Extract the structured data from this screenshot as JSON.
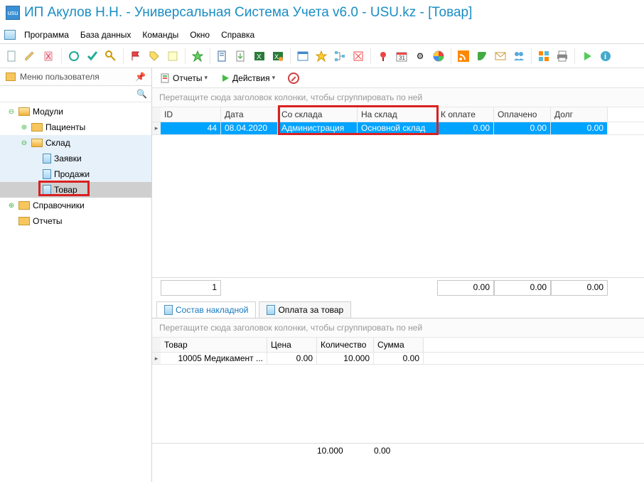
{
  "title": "ИП Акулов Н.Н. - Универсальная Система Учета v6.0 - USU.kz - [Товар]",
  "app_icon_text": "usu",
  "menu": {
    "items": [
      "Программа",
      "База данных",
      "Команды",
      "Окно",
      "Справка"
    ]
  },
  "sidebar": {
    "header": "Меню пользователя",
    "tree": [
      {
        "label": "Модули"
      },
      {
        "label": "Пациенты"
      },
      {
        "label": "Склад"
      },
      {
        "label": "Заявки"
      },
      {
        "label": "Продажи"
      },
      {
        "label": "Товар"
      },
      {
        "label": "Справочники"
      },
      {
        "label": "Отчеты"
      }
    ]
  },
  "content_toolbar": {
    "reports": "Отчеты",
    "actions": "Действия"
  },
  "group_hint": "Перетащите сюда заголовок колонки, чтобы сгруппировать по ней",
  "top_grid": {
    "headers": {
      "id": "ID",
      "date": "Дата",
      "from": "Со склада",
      "to": "На склад",
      "pay": "К оплате",
      "paid": "Оплачено",
      "debt": "Долг"
    },
    "row": {
      "id": "44",
      "date": "08.04.2020",
      "from": "Администрация",
      "to": "Основной склад",
      "pay": "0.00",
      "paid": "0.00",
      "debt": "0.00"
    },
    "footer": {
      "count": "1",
      "pay": "0.00",
      "paid": "0.00",
      "debt": "0.00"
    }
  },
  "tabs": {
    "t1": "Состав накладной",
    "t2": "Оплата за товар"
  },
  "detail_grid": {
    "group_hint": "Перетащите сюда заголовок колонки, чтобы сгруппировать по ней",
    "headers": {
      "name": "Товар",
      "price": "Цена",
      "qty": "Количество",
      "sum": "Сумма"
    },
    "row": {
      "name": "10005 Медикамент ...",
      "price": "0.00",
      "qty": "10.000",
      "sum": "0.00"
    },
    "footer": {
      "qty": "10.000",
      "sum": "0.00"
    }
  }
}
